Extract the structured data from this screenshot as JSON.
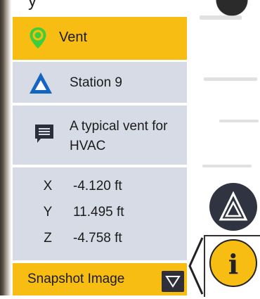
{
  "header": {
    "glyph": "y"
  },
  "point": {
    "title": "Vent",
    "station": "Station 9",
    "description": "A typical vent for HVAC"
  },
  "coords": [
    {
      "axis": "X",
      "value": "-4.120 ft"
    },
    {
      "axis": "Y",
      "value": "11.495 ft"
    },
    {
      "axis": "Z",
      "value": "-4.758 ft"
    }
  ],
  "snapshot": {
    "label": "Snapshot Image"
  },
  "info": {
    "glyph": "i"
  },
  "icons": {
    "pin": "map-pin-icon",
    "station": "station-triangle-icon",
    "description": "comment-icon",
    "snapshot_toggle": "triangle-down-icon",
    "logo": "delta-logo-icon",
    "info": "info-icon",
    "collapse": "chevron-left-icon"
  },
  "colors": {
    "accent": "#f7bd13",
    "row_bg": "#d6dbe6",
    "dark": "#2f3440",
    "pin_green": "#3ccf3c",
    "station_blue": "#1565c0"
  }
}
